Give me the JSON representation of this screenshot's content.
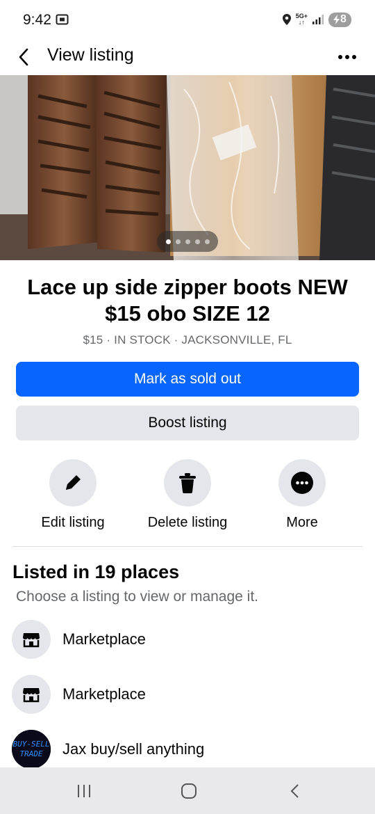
{
  "status_bar": {
    "time": "9:42",
    "network_top": "5G+",
    "network_bottom": "↓↑",
    "battery_level": "8",
    "icons": [
      "screen-cast-icon",
      "location-pin-icon",
      "signal-icon",
      "battery-charging-icon"
    ]
  },
  "header": {
    "title": "View listing",
    "back_icon": "chevron-left-icon",
    "more_icon": "more-horizontal-icon"
  },
  "photo": {
    "alt_subject": "boots",
    "page_count": 5,
    "current_page": 1
  },
  "listing": {
    "title": "Lace up side zipper boots NEW $15 obo SIZE 12",
    "meta": "$15 · IN STOCK · JACKSONVILLE, FL"
  },
  "buttons": {
    "primary": "Mark as sold out",
    "secondary": "Boost listing"
  },
  "actions": [
    {
      "label": "Edit listing",
      "icon": "pencil-icon"
    },
    {
      "label": "Delete listing",
      "icon": "trash-icon"
    },
    {
      "label": "More",
      "icon": "more-horizontal-icon"
    }
  ],
  "places_section": {
    "title": "Listed in 19 places",
    "subtitle": "Choose a listing to view or manage it.",
    "items": [
      {
        "name": "Marketplace",
        "icon": "storefront-icon"
      },
      {
        "name": "Marketplace",
        "icon": "storefront-icon"
      },
      {
        "name": "Jax buy/sell anything",
        "icon": "group-avatar",
        "avatar_text_1": "BUY-SELL",
        "avatar_text_2": "TRADE"
      }
    ]
  },
  "nav_bar": {
    "icons": [
      "recent-apps-icon",
      "home-icon",
      "back-icon"
    ]
  },
  "colors": {
    "primary_button": "#0866ff",
    "secondary_button": "#e4e6eb",
    "muted_text": "#65676b",
    "text": "#050505"
  }
}
